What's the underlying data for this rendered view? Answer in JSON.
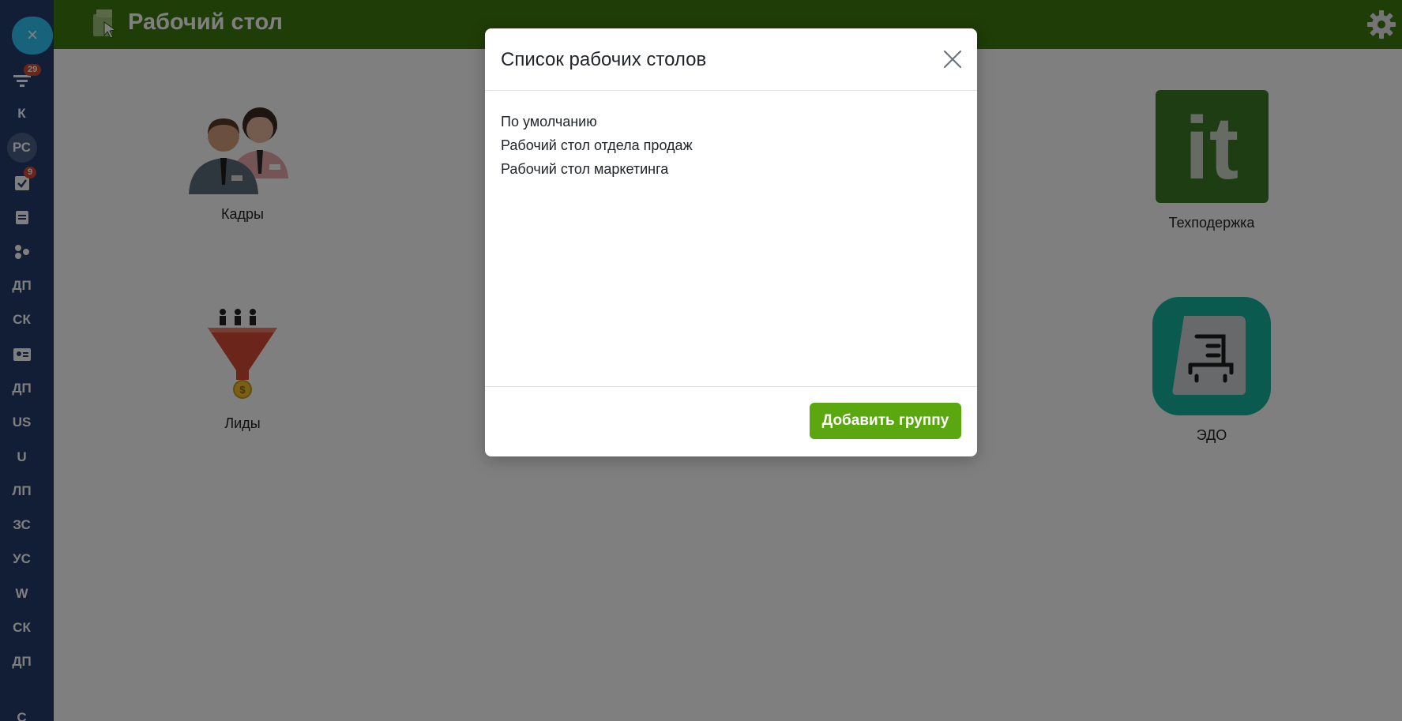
{
  "sidebar": {
    "close_label": "×",
    "items": [
      {
        "label": "",
        "icon": "filter-icon",
        "badge": "29"
      },
      {
        "label": "К"
      },
      {
        "label": "РС",
        "avatar": true
      },
      {
        "label": "",
        "icon": "tasks-check-icon",
        "badge": "9"
      },
      {
        "label": "",
        "icon": "calendar-icon"
      },
      {
        "label": "",
        "icon": "network-icon"
      },
      {
        "label": "ДП"
      },
      {
        "label": "СК"
      },
      {
        "label": "",
        "icon": "contact-card-icon"
      },
      {
        "label": "ДП"
      },
      {
        "label": "US"
      },
      {
        "label": "U"
      },
      {
        "label": "ЛП"
      },
      {
        "label": "ЗС"
      },
      {
        "label": "УС"
      },
      {
        "label": "W"
      },
      {
        "label": "СК"
      },
      {
        "label": "ДП"
      },
      {
        "label": "С"
      }
    ]
  },
  "header": {
    "title": "Рабочий стол",
    "logo_icon": "desktop-logo-icon",
    "settings_icon": "gear-icon"
  },
  "tiles": [
    {
      "label": "Кадры",
      "icon": "staff-people-icon"
    },
    {
      "label": "Техподержка",
      "icon": "it-logo-icon"
    },
    {
      "label": "Лиды",
      "icon": "leads-funnel-icon"
    },
    {
      "label": "ЭДО",
      "icon": "edo-document-icon"
    }
  ],
  "modal": {
    "title": "Список рабочих столов",
    "items": [
      "По умолчанию",
      "Рабочий стол отдела продаж",
      "Рабочий стол маркетинга"
    ],
    "add_button": "Добавить группу"
  },
  "colors": {
    "header_green": "#3f7a0c",
    "sidebar_blue": "#243c6a",
    "accent_cyan": "#2fc6f6",
    "button_green": "#5aa70f",
    "badge_red": "#d64b2d",
    "it_tile": "#3c7a27",
    "edo_tile": "#15b5a0"
  }
}
